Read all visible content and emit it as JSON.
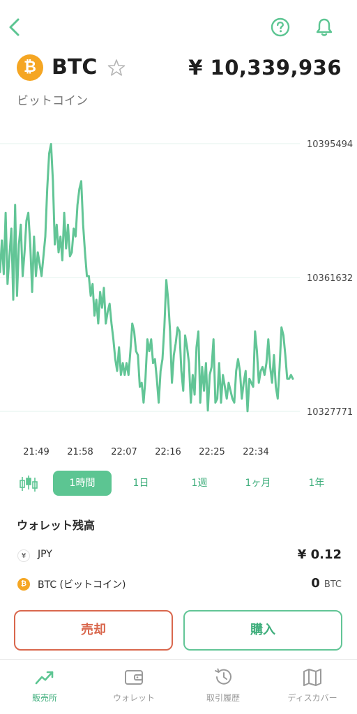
{
  "colors": {
    "accent": "#5cc592",
    "chart_line": "#62c596",
    "sell": "#d9674d",
    "btc": "#f5a623"
  },
  "header": {
    "back_icon": "chevron-left-icon",
    "help_icon": "question-circle-icon",
    "bell_icon": "bell-icon"
  },
  "coin": {
    "logo": "₿",
    "symbol": "BTC",
    "star_icon": "star-outline-icon",
    "price": "¥ 10,339,936",
    "name": "ビットコイン"
  },
  "chart_data": {
    "type": "line",
    "x_tick_labels": [
      "21:49",
      "21:58",
      "22:07",
      "22:16",
      "22:25",
      "22:34"
    ],
    "y_tick_labels": [
      "10395494",
      "10361632",
      "10327771"
    ],
    "ylim": [
      10327771,
      10395494
    ],
    "series": [
      {
        "values": [
          10363000,
          10371000,
          10362500,
          10378000,
          10360000,
          10367000,
          10374000,
          10356000,
          10380000,
          10357000,
          10370000,
          10375000,
          10362000,
          10368000,
          10376000,
          10378000,
          10370000,
          10358000,
          10372000,
          10362000,
          10368000,
          10365000,
          10362000,
          10367000,
          10372000,
          10384000,
          10393000,
          10395400,
          10386000,
          10370000,
          10375000,
          10368000,
          10372000,
          10366000,
          10378000,
          10369000,
          10375000,
          10367000,
          10368000,
          10374000,
          10372000,
          10380000,
          10384000,
          10386000,
          10375000,
          10368000,
          10362000,
          10362000,
          10357000,
          10360000,
          10352000,
          10356000,
          10350000,
          10358000,
          10354000,
          10359000,
          10350000,
          10353000,
          10355000,
          10350000,
          10346000,
          10341000,
          10338000,
          10344000,
          10337000,
          10340000,
          10337000,
          10340000,
          10337000,
          10343000,
          10350000,
          10348000,
          10343000,
          10342000,
          10334000,
          10335000,
          10330000,
          10336000,
          10346000,
          10343000,
          10346000,
          10340000,
          10341000,
          10336000,
          10330000,
          10338000,
          10341000,
          10349000,
          10361000,
          10356000,
          10348000,
          10335000,
          10342000,
          10345000,
          10349000,
          10348000,
          10338000,
          10333000,
          10347000,
          10344000,
          10340000,
          10330000,
          10337000,
          10332000,
          10344000,
          10348000,
          10330000,
          10339000,
          10333000,
          10340000,
          10328000,
          10337000,
          10339000,
          10346000,
          10330000,
          10331000,
          10340000,
          10330000,
          10337000,
          10334000,
          10331000,
          10335000,
          10333000,
          10331000,
          10330000,
          10338000,
          10341000,
          10338000,
          10331000,
          10335000,
          10338000,
          10327800,
          10336000,
          10335000,
          10334000,
          10348000,
          10343000,
          10335000,
          10338000,
          10339000,
          10337000,
          10340000,
          10346000,
          10339000,
          10335000,
          10342000,
          10334000,
          10331000,
          10339000,
          10349000,
          10347000,
          10342000,
          10336000,
          10336000,
          10337000,
          10336000
        ]
      }
    ],
    "grid": true
  },
  "ranges": {
    "candle_icon": "candlestick-icon",
    "items": [
      "1時間",
      "1日",
      "1週",
      "1ヶ月",
      "1年"
    ],
    "active_index": 0
  },
  "wallet": {
    "title": "ウォレット残高",
    "rows": [
      {
        "icon": "¥",
        "label": "JPY",
        "value": "¥ 0.12",
        "unit": ""
      },
      {
        "icon": "₿",
        "label": "BTC (ビットコイン)",
        "value": "0",
        "unit": "BTC"
      }
    ]
  },
  "actions": {
    "sell_label": "売却",
    "buy_label": "購入"
  },
  "tabbar": {
    "items": [
      {
        "label": "販売所",
        "icon": "trend-chart-icon",
        "active": true
      },
      {
        "label": "ウォレット",
        "icon": "wallet-icon",
        "active": false
      },
      {
        "label": "取引履歴",
        "icon": "history-icon",
        "active": false
      },
      {
        "label": "ディスカバー",
        "icon": "map-icon",
        "active": false
      }
    ]
  }
}
